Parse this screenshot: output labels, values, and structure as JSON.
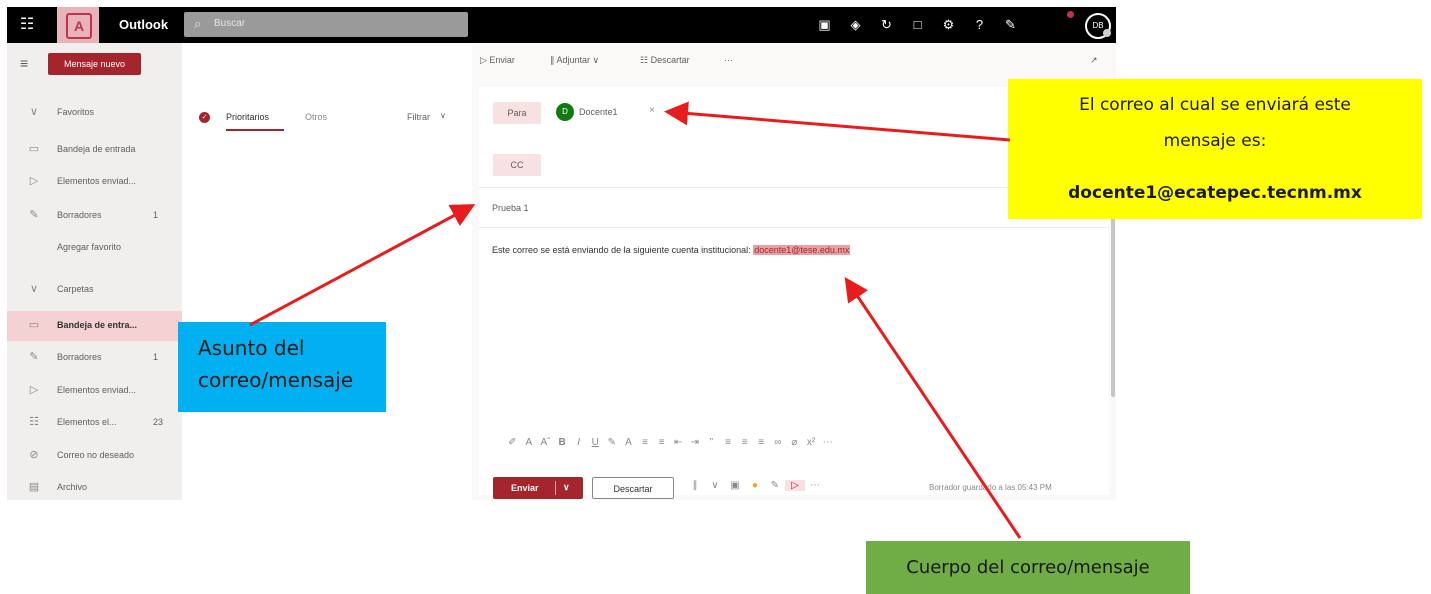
{
  "app": {
    "name": "Outlook",
    "search_placeholder": "Buscar",
    "avatar_initials": "DB"
  },
  "top_icons": [
    "meet-now-icon",
    "teams-icon",
    "sync-icon",
    "bell-icon",
    "settings-icon",
    "help-icon",
    "feedback-icon"
  ],
  "nav": {
    "new_message": "Mensaje nuevo",
    "items": [
      {
        "icon": "chevron",
        "label": "Favoritos",
        "count": ""
      },
      {
        "icon": "inbox",
        "label": "Bandeja de entrada",
        "count": ""
      },
      {
        "icon": "sent",
        "label": "Elementos enviad...",
        "count": ""
      },
      {
        "icon": "pencil",
        "label": "Borradores",
        "count": "1"
      },
      {
        "icon": "none",
        "label": "Agregar favorito",
        "count": ""
      },
      {
        "icon": "chevron",
        "label": "Carpetas",
        "count": ""
      },
      {
        "icon": "inbox",
        "label": "Bandeja de entra...",
        "count": ""
      },
      {
        "icon": "pencil",
        "label": "Borradores",
        "count": "1"
      },
      {
        "icon": "sent",
        "label": "Elementos enviad...",
        "count": ""
      },
      {
        "icon": "trash",
        "label": "Elementos el...",
        "count": "23"
      },
      {
        "icon": "junk",
        "label": "Correo no deseado",
        "count": ""
      },
      {
        "icon": "archive",
        "label": "Archivo",
        "count": ""
      }
    ]
  },
  "list": {
    "tab_focused": "Prioritarios",
    "tab_other": "Otros",
    "filter": "Filtrar"
  },
  "toolbar": {
    "send": "Enviar",
    "attach": "Adjuntar",
    "discard": "Descartar",
    "more": "···"
  },
  "compose": {
    "to_label": "Para",
    "recipient_initial": "D",
    "recipient_name": "Docente1",
    "cc_label": "CC",
    "subject": "Prueba 1",
    "body_prefix": "Este correo se está enviando de la siguiente cuenta institucional:",
    "body_highlight": "docente1@tese.edu.mx",
    "send": "Enviar",
    "discard": "Descartar",
    "draft_status": "Borrador guardado a las 05:43 PM"
  },
  "annotations": {
    "recipient_line1": "El correo al cual se enviará este",
    "recipient_line2": "mensaje es:",
    "recipient_email": "docente1@ecatepec.tecnm.mx",
    "subject_line1": "Asunto del",
    "subject_line2": "correo/mensaje",
    "body_label": "Cuerpo del correo/mensaje"
  },
  "colors": {
    "accent": "#a4262c",
    "yellow": "#ffff00",
    "blue": "#00b0f0",
    "green": "#70ad47",
    "arrow": "#e81c1c"
  }
}
